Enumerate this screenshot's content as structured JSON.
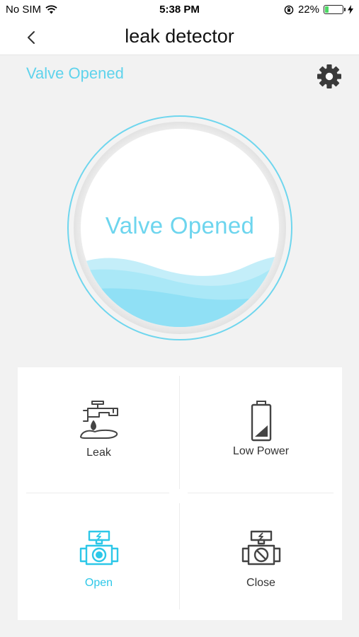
{
  "status_bar": {
    "carrier": "No SIM",
    "time": "5:38 PM",
    "battery_percent": "22%",
    "battery_level": 0.22,
    "icons": [
      "wifi-icon",
      "orientation-lock-icon",
      "battery-icon",
      "charging-bolt-icon"
    ]
  },
  "nav": {
    "title": "leak detector",
    "back_icon": "chevron-left-icon"
  },
  "header": {
    "valve_status": "Valve Opened",
    "settings_icon": "gear-icon"
  },
  "gauge": {
    "label": "Valve Opened",
    "water_level": 0.3
  },
  "grid": {
    "items": [
      {
        "label": "Leak",
        "icon": "leaking-faucet-icon"
      },
      {
        "label": "Low Power",
        "icon": "low-battery-icon"
      },
      {
        "label": "Open",
        "icon": "valve-open-icon"
      },
      {
        "label": "Close",
        "icon": "valve-closed-icon"
      }
    ]
  },
  "colors": {
    "accent": "#5fd3ec",
    "water_light": "#c4eef9",
    "water_dark": "#8ddff4",
    "icon_dark": "#444444",
    "background": "#f2f2f2"
  }
}
